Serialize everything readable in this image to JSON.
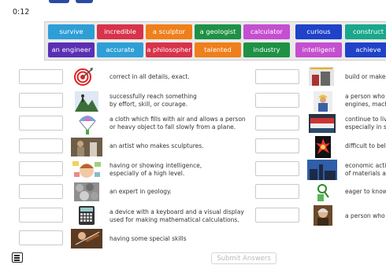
{
  "timer": "0:12",
  "tiles": [
    {
      "label": "survive",
      "color": "#2e9fd6"
    },
    {
      "label": "incredible",
      "color": "#d8334a"
    },
    {
      "label": "a sculptor",
      "color": "#ef7f1a"
    },
    {
      "label": "a geologist",
      "color": "#1e9145"
    },
    {
      "label": "calculator",
      "color": "#c44fd0"
    },
    {
      "label": "curious",
      "color": "#1f42c8"
    },
    {
      "label": "construct",
      "color": "#1aa78c"
    },
    {
      "label": "an engineer",
      "color": "#5a2fb3"
    },
    {
      "label": "accurate",
      "color": "#2e9fd6"
    },
    {
      "label": "a philosopher",
      "color": "#d8334a"
    },
    {
      "label": "talented",
      "color": "#ef7f1a"
    },
    {
      "label": "industry",
      "color": "#1e9145"
    },
    {
      "label": "intelligent",
      "color": "#c44fd0"
    },
    {
      "label": "achieve",
      "color": "#1f42c8"
    }
  ],
  "left_items": [
    {
      "text": "correct in all details, exact.",
      "icon": "target-arrow-icon"
    },
    {
      "text": "successfully reach something\nby effort, skill, or courage.",
      "icon": "mountain-climber-icon"
    },
    {
      "text": "a cloth which fills with air and allows a person\nor heavy object to fall slowly from a plane.",
      "icon": "parachute-icon"
    },
    {
      "text": "an artist who makes sculptures.",
      "icon": "sculptor-photo"
    },
    {
      "text": "having or showing intelligence,\nespecially of a high level.",
      "icon": "thinking-person-icon"
    },
    {
      "text": "an expert in geology.",
      "icon": "rocks-photo"
    },
    {
      "text": "a device with a keyboard and a visual display\nused for making mathematical calculations.",
      "icon": "calculator-icon"
    },
    {
      "text": "having some special skills",
      "icon": "violinist-photo"
    }
  ],
  "right_items": [
    {
      "text": "build or make",
      "icon": "building-icon"
    },
    {
      "text": "a person who\nengines, mach",
      "icon": "engineer-icon"
    },
    {
      "text": "continue to liv\nespecially in s",
      "icon": "lifeboat-photo"
    },
    {
      "text": "difficult to bel",
      "icon": "explosion-icon"
    },
    {
      "text": "economic acti\nof materials a",
      "icon": "factory-photo"
    },
    {
      "text": "eager to know",
      "icon": "magnifier-person-icon"
    },
    {
      "text": "a person who",
      "icon": "philosopher-portrait"
    }
  ],
  "submit_label": "Submit Answers"
}
